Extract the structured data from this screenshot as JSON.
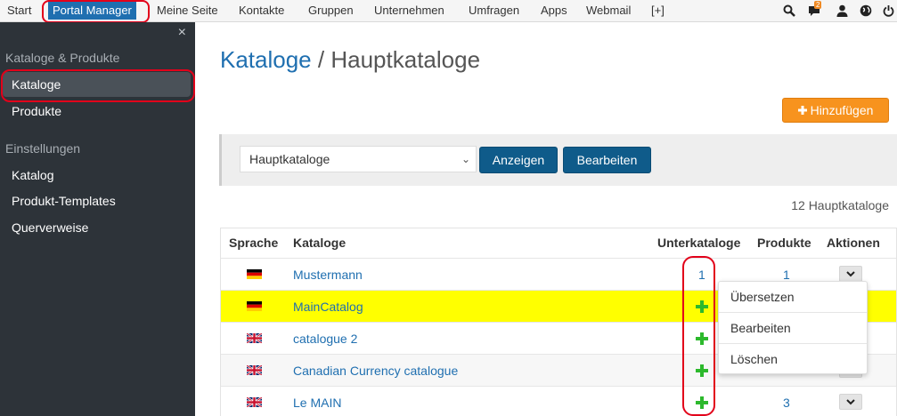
{
  "topnav": {
    "items": [
      "Start",
      "Portal Manager",
      "Meine Seite",
      "Kontakte",
      "Gruppen",
      "Unternehmen",
      "Umfragen",
      "Apps",
      "Webmail",
      "[+]"
    ],
    "active": "Portal Manager",
    "notification_count": "2",
    "icons": [
      "search-icon",
      "chat-icon",
      "user-icon",
      "globe-icon",
      "power-icon"
    ],
    "active_color": "#1f6fb0"
  },
  "sidebar": {
    "close_label": "×",
    "section1": "Kataloge & Produkte",
    "kataloge": "Kataloge",
    "produkte": "Produkte",
    "section2": "Einstellungen",
    "katalog": "Katalog",
    "produkt_templates": "Produkt-Templates",
    "querverweise": "Querverweise"
  },
  "main": {
    "breadcrumb_link": "Kataloge",
    "breadcrumb_sep": "/",
    "breadcrumb_current": "Hauptkataloge",
    "add_button": "Hinzufügen",
    "add_icon": "plus-icon",
    "filter": {
      "selected": "Hauptkataloge",
      "show_button": "Anzeigen",
      "edit_button": "Bearbeiten"
    },
    "count": "12 Hauptkataloge"
  },
  "table": {
    "headers": {
      "sprache": "Sprache",
      "kataloge": "Kataloge",
      "unterkataloge": "Unterkataloge",
      "produkte": "Produkte",
      "aktionen": "Aktionen"
    },
    "rows": [
      {
        "flag": "de",
        "name": "Mustermann",
        "unterkataloge": "1",
        "produkte": "1",
        "highlight": false
      },
      {
        "flag": "de",
        "name": "MainCatalog",
        "unterkataloge": "+",
        "produkte": "",
        "highlight": true
      },
      {
        "flag": "uk",
        "name": "catalogue 2",
        "unterkataloge": "+",
        "produkte": "",
        "highlight": false
      },
      {
        "flag": "uk",
        "name": "Canadian Currency catalogue",
        "unterkataloge": "+",
        "produkte": "",
        "highlight": false
      },
      {
        "flag": "uk",
        "name": "Le MAIN",
        "unterkataloge": "+",
        "produkte": "3",
        "highlight": false
      }
    ]
  },
  "dropdown": {
    "items": [
      "Übersetzen",
      "Bearbeiten",
      "Löschen"
    ]
  },
  "colors": {
    "annotation_red": "#e2001a",
    "highlight_yellow": "#ffff00",
    "link_blue": "#1f6fb0",
    "sidebar_bg": "#2d3339",
    "orange": "#f7931e",
    "dark_blue_button": "#0f5b8a",
    "plus_green": "#2db92d"
  }
}
